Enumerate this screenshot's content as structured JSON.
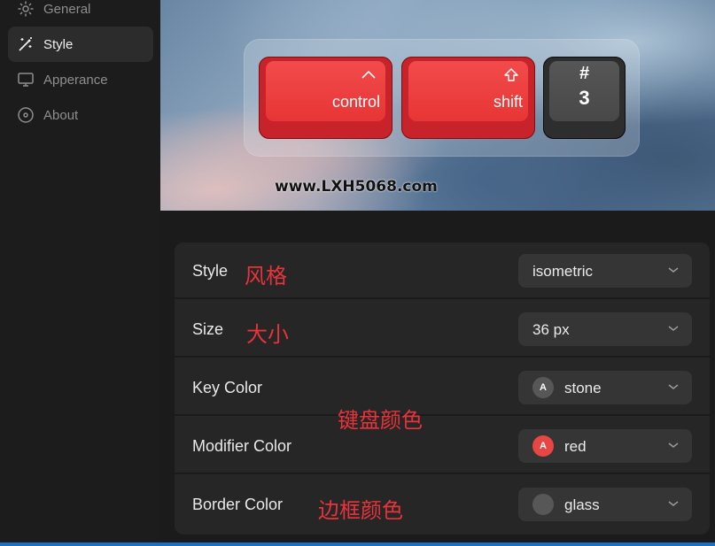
{
  "sidebar": {
    "items": [
      {
        "label": "General",
        "icon": "gear-icon"
      },
      {
        "label": "Style",
        "icon": "magic-wand-icon"
      },
      {
        "label": "Apperance",
        "icon": "monitor-icon"
      },
      {
        "label": "About",
        "icon": "disc-icon"
      }
    ],
    "active": "Style"
  },
  "preview": {
    "keys": [
      {
        "label": "control",
        "glyph": "caret-up-icon",
        "color": "#e83535"
      },
      {
        "label": "shift",
        "glyph": "shift-arrow-icon",
        "color": "#e83535"
      },
      {
        "symbol": "#",
        "main": "3",
        "color": "#484848"
      }
    ],
    "watermark": "www.LXH5068.com"
  },
  "settings": {
    "rows": [
      {
        "label": "Style",
        "value": "isometric"
      },
      {
        "label": "Size",
        "value": "36 px"
      },
      {
        "label": "Key Color",
        "value": "stone",
        "swatch_text": "A",
        "swatch_color": "#575757"
      },
      {
        "label": "Modifier Color",
        "value": "red",
        "swatch_text": "A",
        "swatch_color": "#e84545"
      },
      {
        "label": "Border Color",
        "value": "glass",
        "swatch_text": "",
        "swatch_color": "#575757"
      }
    ]
  },
  "annotations": {
    "style": "风格",
    "size": "大小",
    "key_color": "键盘颜色",
    "border_color": "边框颜色"
  },
  "colors": {
    "accent_red": "#e8333a",
    "bottom_bar": "#1f6fbf"
  }
}
